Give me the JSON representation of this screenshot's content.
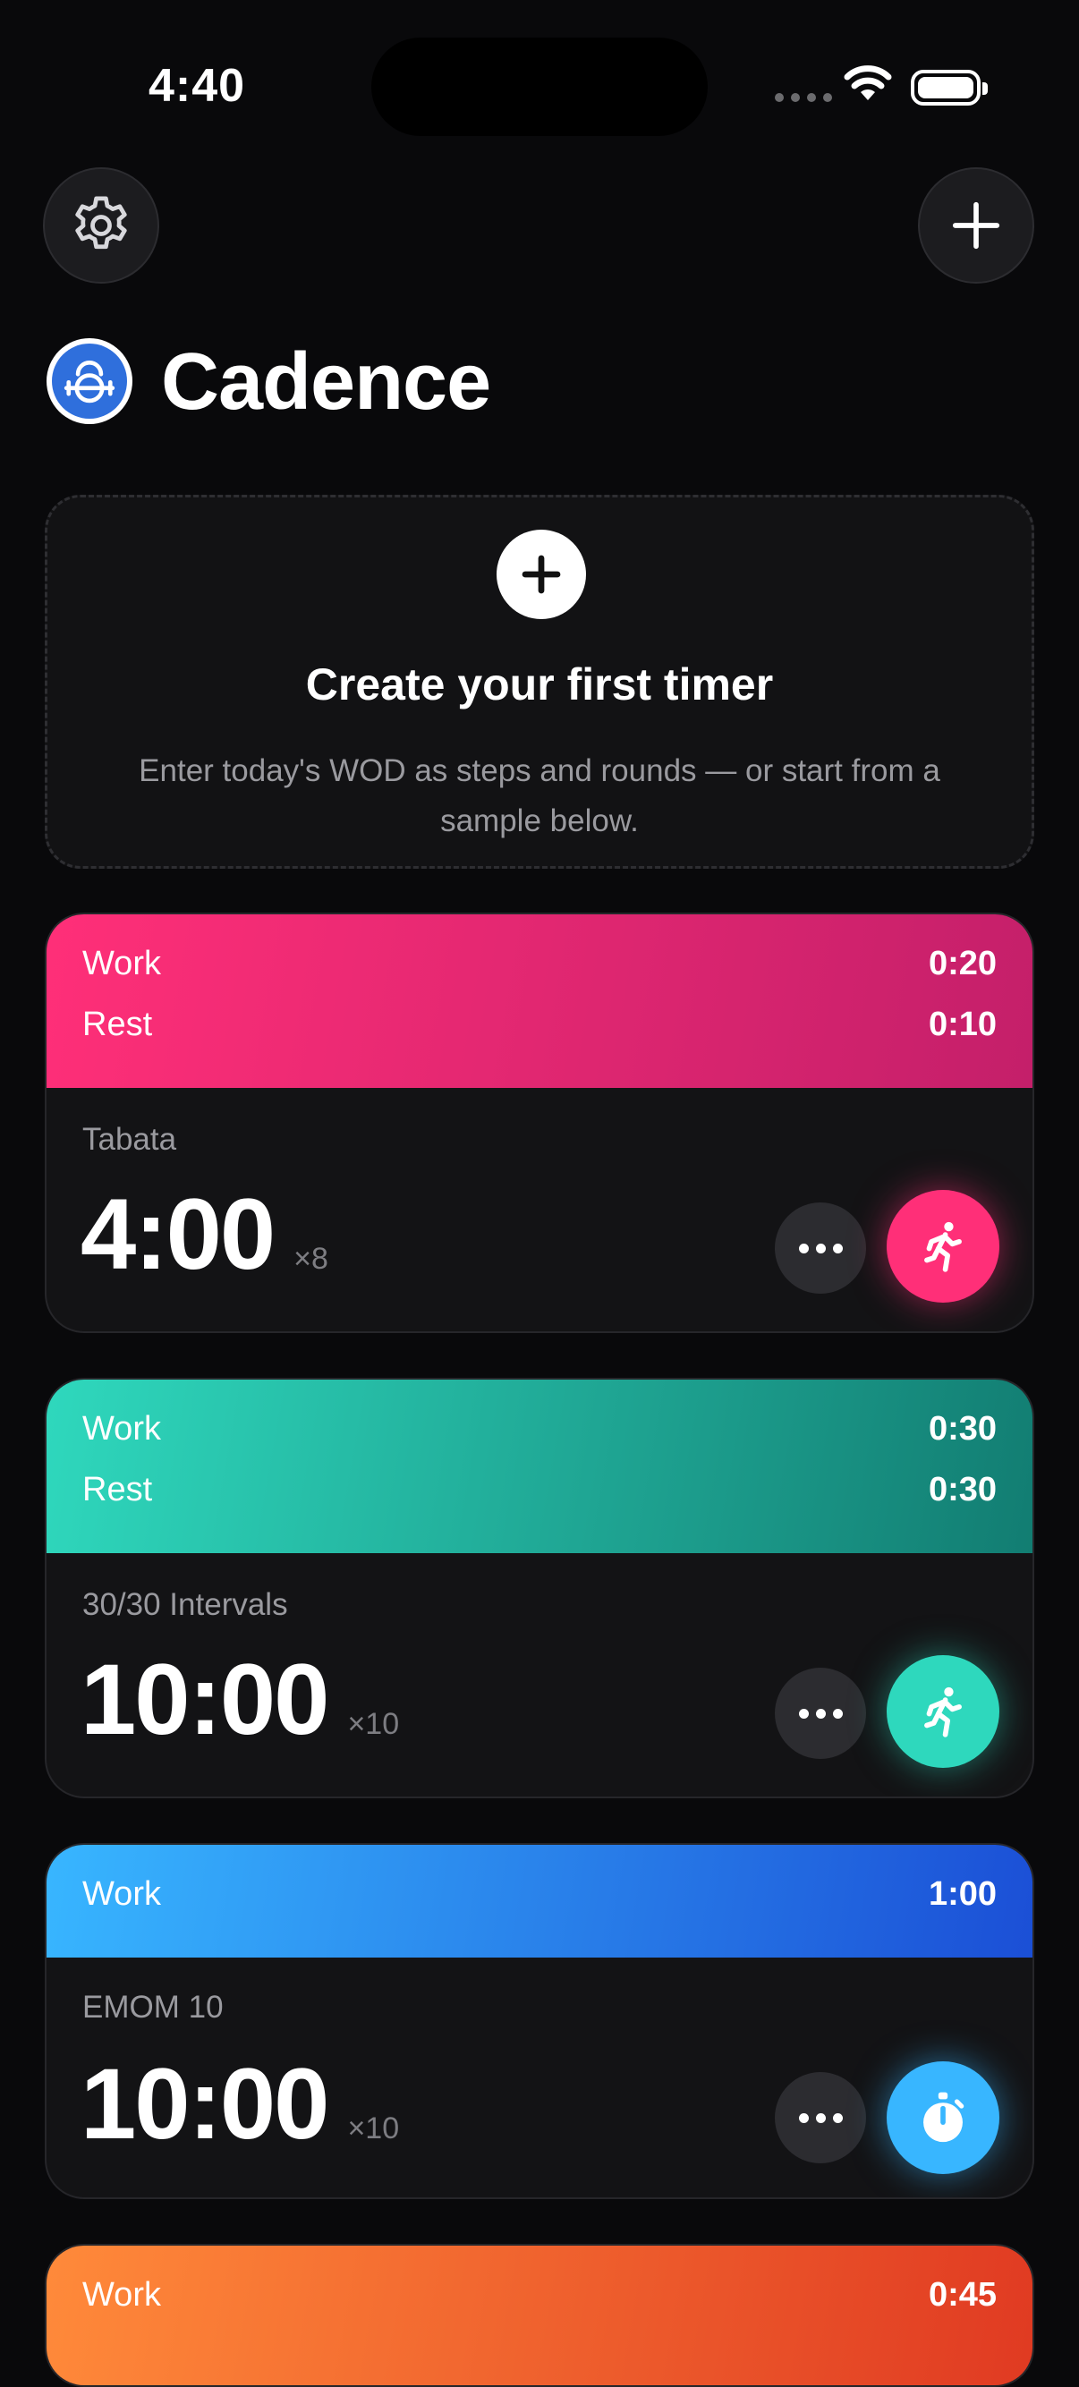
{
  "status_bar": {
    "time": "4:40"
  },
  "app": {
    "title": "Cadence"
  },
  "create_card": {
    "title": "Create your first timer",
    "description": "Enter today's WOD as steps and rounds — or start from a sample below."
  },
  "timers": [
    {
      "name": "Tabata",
      "total": "4:00",
      "rounds": "×8",
      "accent": "#ff2f78",
      "steps": [
        {
          "label": "Work",
          "value": "0:20"
        },
        {
          "label": "Rest",
          "value": "0:10"
        }
      ],
      "icon": "running-icon"
    },
    {
      "name": "30/30 Intervals",
      "total": "10:00",
      "rounds": "×10",
      "accent": "#2ed8bd",
      "steps": [
        {
          "label": "Work",
          "value": "0:30"
        },
        {
          "label": "Rest",
          "value": "0:30"
        }
      ],
      "icon": "running-icon"
    },
    {
      "name": "EMOM 10",
      "total": "10:00",
      "rounds": "×10",
      "accent": "#38b6ff",
      "steps": [
        {
          "label": "Work",
          "value": "1:00"
        }
      ],
      "icon": "stopwatch-icon"
    },
    {
      "accent": "#ff8a3a",
      "steps": [
        {
          "label": "Work",
          "value": "0:45"
        }
      ]
    }
  ]
}
